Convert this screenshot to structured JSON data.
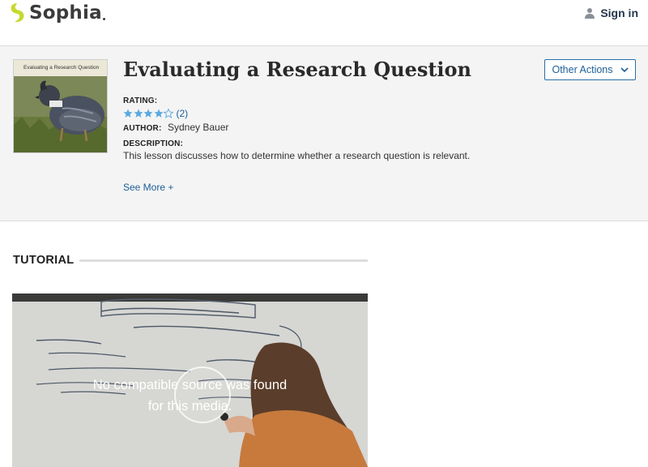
{
  "header": {
    "brand": "Sophia",
    "signin_label": "Sign in",
    "icons": {
      "logo": "sophia-leaf-logo",
      "user": "user-icon"
    },
    "brand_color": "#c5d92d"
  },
  "lesson": {
    "thumbnail_caption": "Evaluating a Research Question",
    "title": "Evaluating a Research Question",
    "other_actions_label": "Other Actions",
    "rating_label": "RATING:",
    "rating_stars": 4,
    "rating_max": 5,
    "rating_count": "(2)",
    "author_label": "AUTHOR:",
    "author_name": "Sydney Bauer",
    "description_label": "DESCRIPTION:",
    "description": "This lesson discusses how to determine whether a research question is relevant.",
    "see_more_label": "See More +"
  },
  "tutorial": {
    "heading": "TUTORIAL",
    "video_message_line1": "No compatible source was found",
    "video_message_line2": "for this media."
  },
  "colors": {
    "link": "#1d5e98",
    "star": "#5aa9df",
    "band_bg": "#f4f4f4"
  }
}
